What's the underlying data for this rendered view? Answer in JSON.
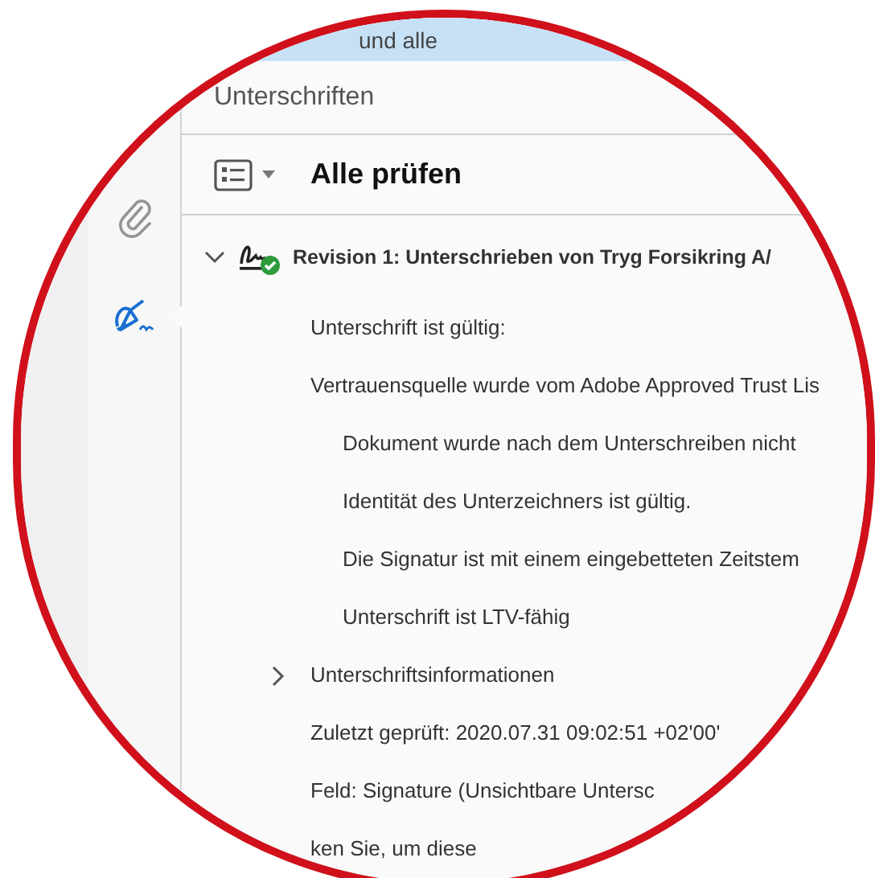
{
  "banner": {
    "text": "und alle"
  },
  "panel": {
    "title": "Unterschriften"
  },
  "sidebar": {
    "items": [
      {
        "kind": "attachments",
        "selected": false
      },
      {
        "kind": "signatures",
        "selected": true
      }
    ]
  },
  "toolbar": {
    "action": "Alle prüfen"
  },
  "tree": [
    {
      "label": "Revision 1: Unterschrieben von Tryg Forsikring A/",
      "valid": true,
      "expanded": true,
      "children": [
        {
          "label": "Unterschrift ist gültig:"
        },
        {
          "label": "Vertrauensquelle wurde vom Adobe Approved Trust Lis",
          "children": [
            {
              "label": "Dokument wurde nach dem Unterschreiben nicht"
            },
            {
              "label": "Identität des Unterzeichners ist gültig."
            },
            {
              "label": "Die Signatur ist mit einem eingebetteten Zeitstem"
            },
            {
              "label": "Unterschrift ist LTV-fähig"
            }
          ]
        },
        {
          "label": "Unterschriftsinformationen",
          "expanded": false
        },
        {
          "label": "Zuletzt geprüft: 2020.07.31 09:02:51 +02'00'"
        },
        {
          "label": "Feld: Signature (Unsichtbare Untersc"
        },
        {
          "label": "ken Sie, um diese"
        }
      ]
    }
  ]
}
